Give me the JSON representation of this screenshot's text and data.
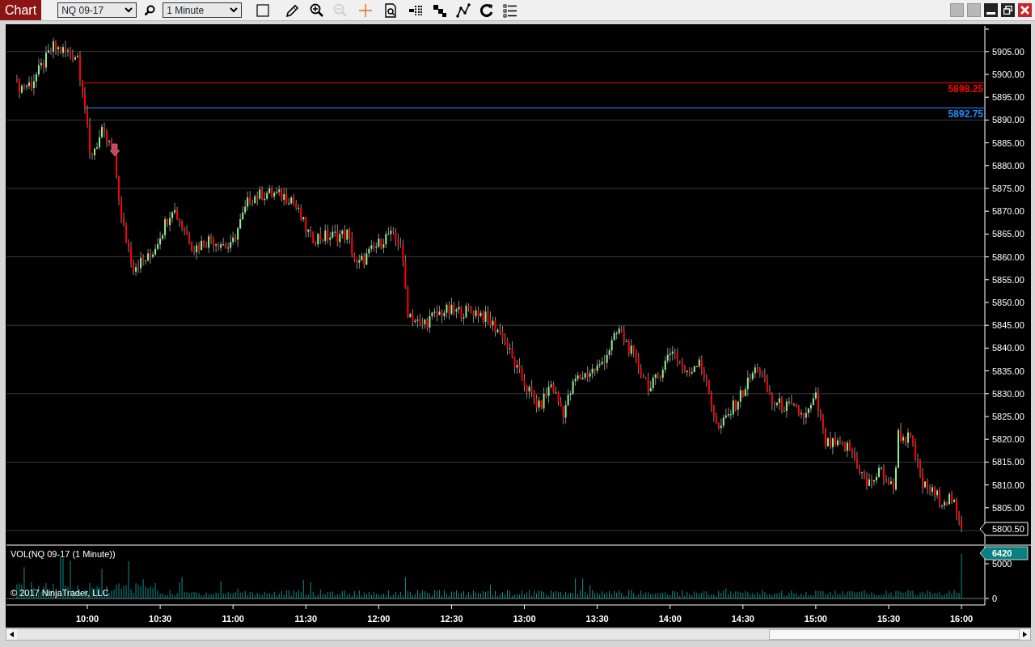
{
  "window": {
    "title": "Chart"
  },
  "toolbar": {
    "instrument": "NQ 09-17",
    "interval": "1 Minute",
    "tools": [
      {
        "kind": "select",
        "disabled": false
      },
      {
        "kind": "pencil",
        "disabled": false
      },
      {
        "kind": "zoom_in",
        "disabled": false
      },
      {
        "kind": "zoom_out",
        "disabled": true
      },
      {
        "kind": "crosshair",
        "disabled": false
      },
      {
        "kind": "data_box",
        "disabled": false
      },
      {
        "kind": "bars",
        "disabled": false
      },
      {
        "kind": "steps",
        "disabled": false
      },
      {
        "kind": "indicators",
        "disabled": false
      },
      {
        "kind": "reload",
        "disabled": false
      },
      {
        "kind": "list",
        "disabled": false
      }
    ]
  },
  "price_axis": {
    "ticks": [
      "5905.00",
      "5900.00",
      "5895.00",
      "5890.00",
      "5885.00",
      "5880.00",
      "5875.00",
      "5870.00",
      "5865.00",
      "5860.00",
      "5855.00",
      "5850.00",
      "5845.00",
      "5840.00",
      "5835.00",
      "5830.00",
      "5825.00",
      "5820.00",
      "5815.00",
      "5810.00",
      "5805.00"
    ]
  },
  "levels": [
    {
      "price": "5898.25",
      "color": "#ff0000"
    },
    {
      "price": "5892.75",
      "color": "#1e90ff"
    }
  ],
  "last_price": "5800.50",
  "volume_panel": {
    "title": "VOL(NQ 09-17 (1 Minute))",
    "ticks": [
      "5000",
      "0"
    ],
    "last_volume": "6420"
  },
  "copyright": "© 2017 NinjaTrader, LLC",
  "time_axis": {
    "ticks": [
      "10:00",
      "10:30",
      "11:00",
      "11:30",
      "12:00",
      "12:30",
      "13:00",
      "13:30",
      "14:00",
      "14:30",
      "15:00",
      "15:30",
      "16:00"
    ]
  }
}
